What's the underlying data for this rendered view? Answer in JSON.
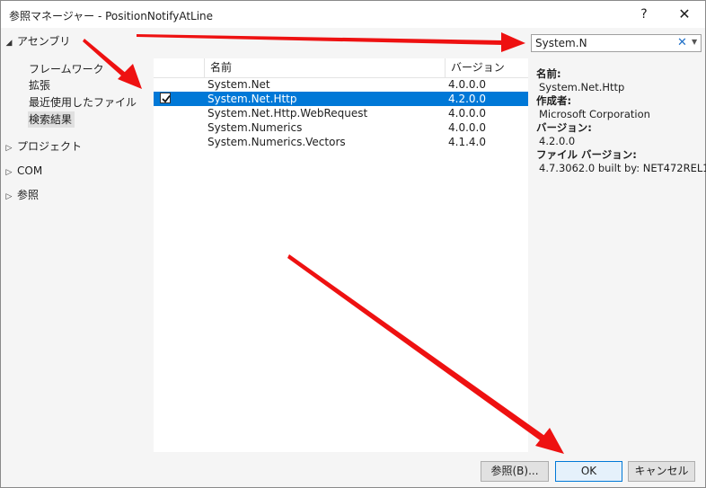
{
  "window": {
    "title": "参照マネージャー - PositionNotifyAtLine",
    "help": "?",
    "close": "✕"
  },
  "sidebar": {
    "assembly": "アセンブリ",
    "assembly_items": [
      "フレームワーク",
      "拡張",
      "最近使用したファイル",
      "検索結果"
    ],
    "project": "プロジェクト",
    "com": "COM",
    "browse": "参照"
  },
  "list": {
    "headers": {
      "name": "名前",
      "version": "バージョン"
    },
    "rows": [
      {
        "name": "System.Net",
        "version": "4.0.0.0",
        "checked": false
      },
      {
        "name": "System.Net.Http",
        "version": "4.2.0.0",
        "checked": true
      },
      {
        "name": "System.Net.Http.WebRequest",
        "version": "4.0.0.0",
        "checked": false
      },
      {
        "name": "System.Numerics",
        "version": "4.0.0.0",
        "checked": false
      },
      {
        "name": "System.Numerics.Vectors",
        "version": "4.1.4.0",
        "checked": false
      }
    ]
  },
  "search": {
    "value": "System.N"
  },
  "details": {
    "name_label": "名前:",
    "name_value": "System.Net.Http",
    "author_label": "作成者:",
    "author_value": "Microsoft Corporation",
    "version_label": "バージョン:",
    "version_value": "4.2.0.0",
    "file_version_label": "ファイル バージョン:",
    "file_version_value": "4.7.3062.0 built by: NET472REL1"
  },
  "footer": {
    "browse_button": "参照(B)...",
    "ok_button": "OK",
    "cancel_button": "キャンセル"
  },
  "colors": {
    "selection": "#0078d7",
    "arrow": "#ee1111"
  }
}
